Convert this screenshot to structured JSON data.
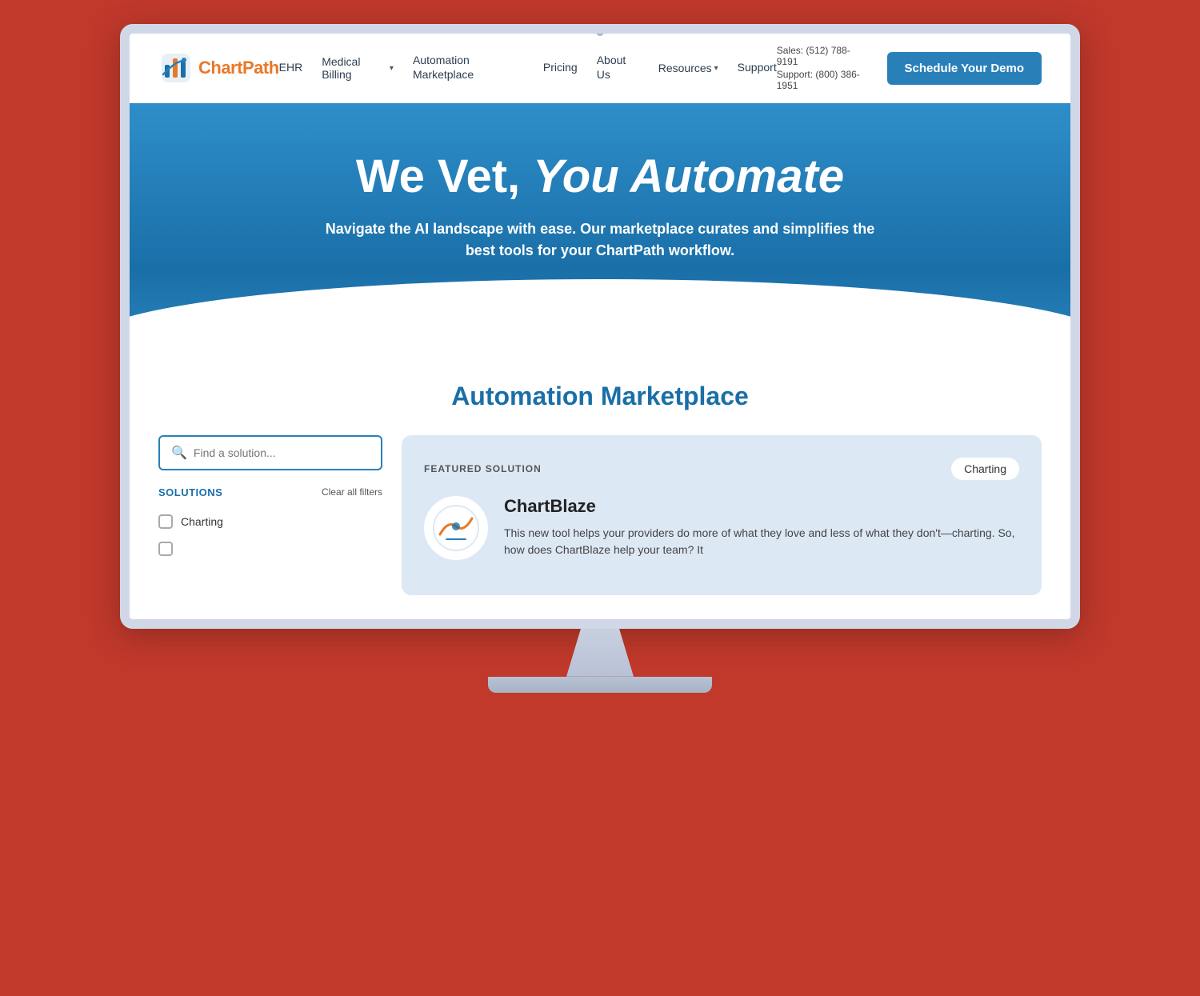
{
  "monitor": {
    "dot": ""
  },
  "nav": {
    "logo_text_main": "Chart",
    "logo_text_accent": "Path",
    "links": [
      {
        "label": "EHR",
        "has_dropdown": false
      },
      {
        "label": "Medical Billing",
        "has_dropdown": true
      },
      {
        "label": "Automation Marketplace",
        "has_dropdown": false
      },
      {
        "label": "Pricing",
        "has_dropdown": false
      },
      {
        "label": "About Us",
        "has_dropdown": false
      },
      {
        "label": "Resources",
        "has_dropdown": true
      },
      {
        "label": "Support",
        "has_dropdown": false
      }
    ],
    "sales_phone": "Sales: (512) 788-9191",
    "support_phone": "Support: (800) 386-1951",
    "schedule_btn": "Schedule Your Demo"
  },
  "hero": {
    "heading_part1": "We Vet, ",
    "heading_italic": "You Automate",
    "subtext": "Navigate the AI landscape with ease. Our marketplace curates and simplifies the best tools for your ChartPath workflow."
  },
  "marketplace": {
    "title": "Automation Marketplace",
    "search_placeholder": "Find a solution...",
    "solutions_label": "SOLUTIONS",
    "clear_filters": "Clear all filters",
    "filters": [
      {
        "label": "Charting",
        "checked": false
      },
      {
        "label": "",
        "checked": false
      }
    ],
    "featured": {
      "label": "FEATURED SOLUTION",
      "badge": "Charting",
      "product_name": "ChartBlaze",
      "product_desc": "This new tool helps your providers do more of what they love and less of what they don't—charting. So, how does ChartBlaze help your team? It"
    }
  }
}
